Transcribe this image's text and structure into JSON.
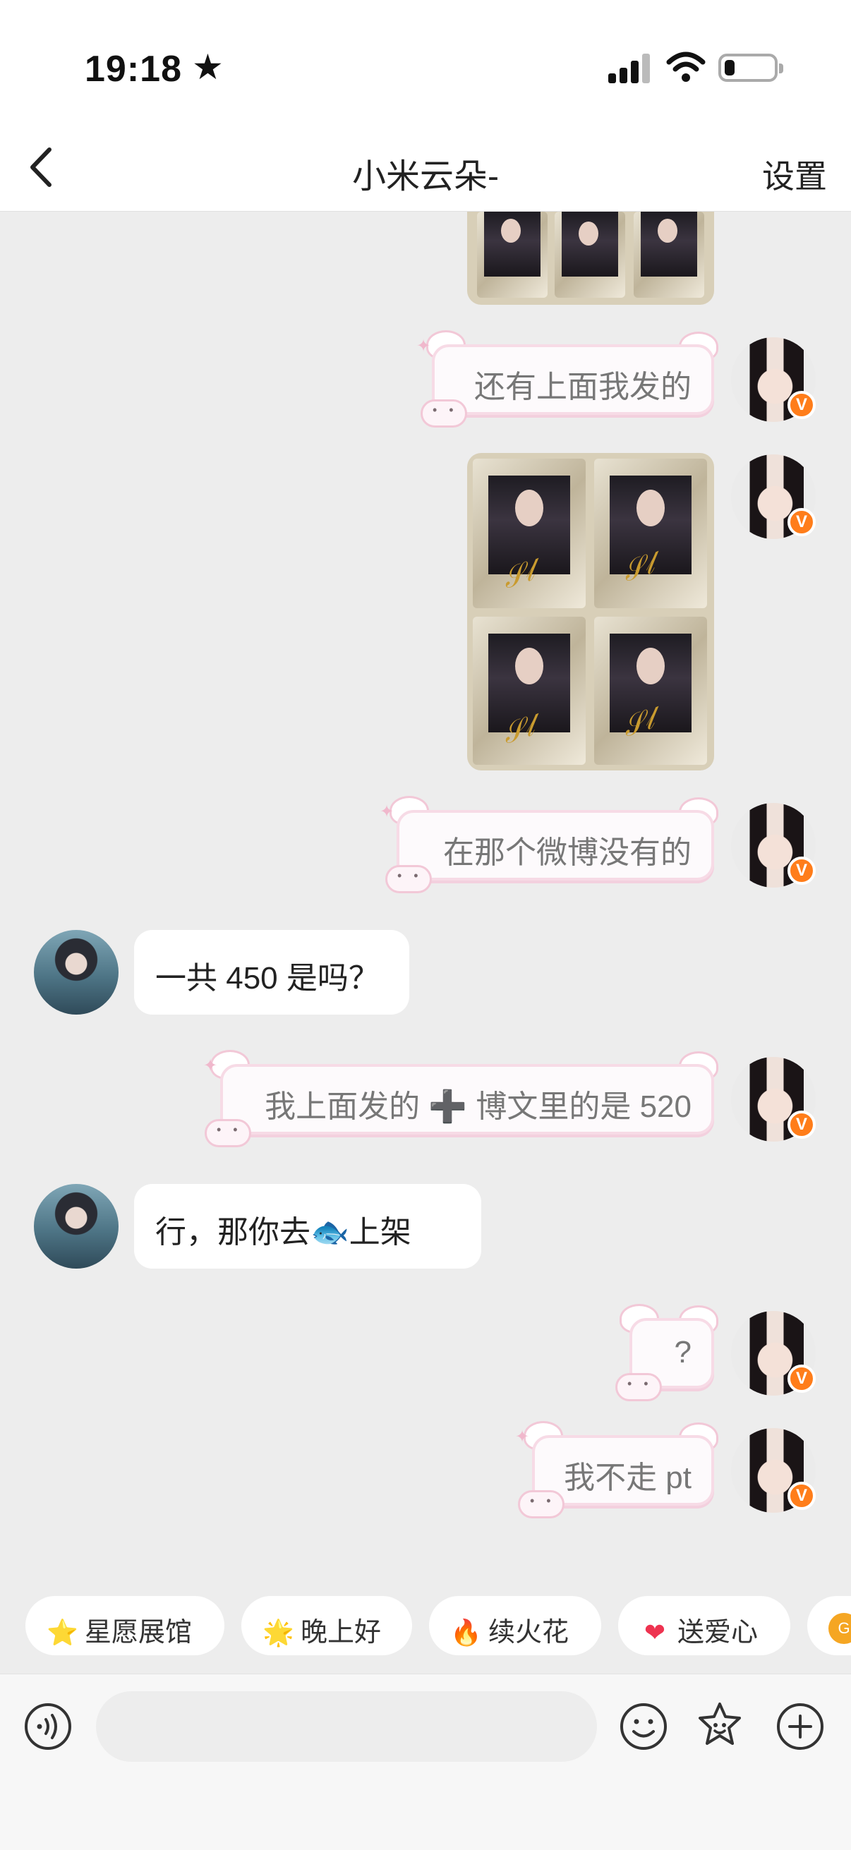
{
  "status_bar": {
    "time": "19:18",
    "star_glyph": "★",
    "signal_icon": "cellular-signal-icon",
    "wifi_icon": "wifi-icon",
    "battery_icon": "battery-low-icon"
  },
  "nav": {
    "back_icon": "chevron-left-icon",
    "title": "小米云朵-",
    "settings": "设置"
  },
  "messages": [
    {
      "side": "right",
      "type": "image",
      "description_icon": "photo-cards-partial-image"
    },
    {
      "side": "right",
      "type": "text",
      "text": "还有上面我发的"
    },
    {
      "side": "right",
      "type": "image",
      "description_icon": "photo-cards-image"
    },
    {
      "side": "right",
      "type": "text",
      "text": "在那个微博没有的"
    },
    {
      "side": "left",
      "type": "text",
      "text": "一共 450 是吗？"
    },
    {
      "side": "right",
      "type": "text",
      "text": "我上面发的 ➕ 博文里的是 520"
    },
    {
      "side": "left",
      "type": "text",
      "text_before": "行，那你去",
      "emoji": "🐟",
      "text_after": "上架"
    },
    {
      "side": "right",
      "type": "text",
      "text": "?"
    },
    {
      "side": "right",
      "type": "text",
      "text": "我不走 pt"
    }
  ],
  "verified_badge": "V",
  "quick_chips": [
    {
      "icon": "⭐",
      "label": "星愿展馆"
    },
    {
      "icon": "🌟",
      "label": "晚上好"
    },
    {
      "icon": "🔥",
      "label": "续火花"
    },
    {
      "icon": "❤",
      "label": "送爱心"
    },
    {
      "icon": "G",
      "label": ""
    }
  ],
  "input_bar": {
    "voice_icon": "voice-icon",
    "input_placeholder": "",
    "emoji_icon": "emoji-icon",
    "sticker_icon": "sticker-icon",
    "plus_icon": "plus-icon"
  },
  "colors": {
    "badge": "#ff7d1a",
    "cute_border": "#f7dbe6",
    "chat_bg": "#ededed"
  }
}
